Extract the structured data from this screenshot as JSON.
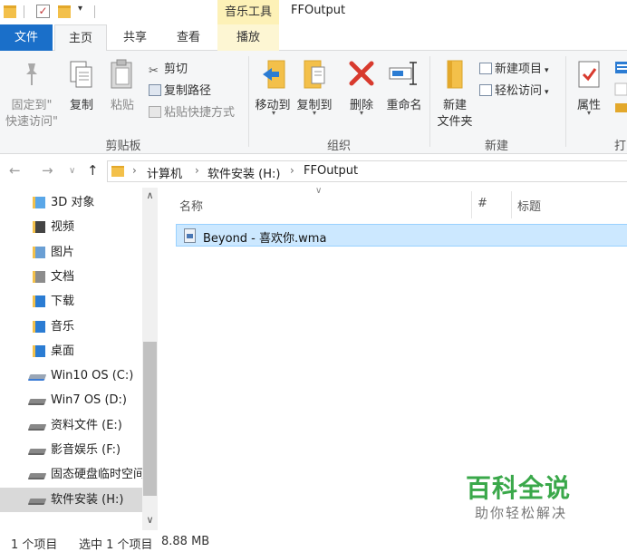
{
  "window": {
    "title": "FFOutput",
    "context_tab_group": "音乐工具"
  },
  "quick_access": {
    "dropdown_glyph": "▾",
    "check_glyph": "✓"
  },
  "tabs": {
    "file": "文件",
    "home": "主页",
    "share": "共享",
    "view": "查看",
    "play": "播放"
  },
  "ribbon": {
    "clipboard": {
      "label": "剪贴板",
      "pin_line1": "固定到\"",
      "pin_line2": "快速访问\"",
      "copy": "复制",
      "paste": "粘贴",
      "cut": "剪切",
      "copy_path": "复制路径",
      "paste_shortcut": "粘贴快捷方式"
    },
    "organize": {
      "label": "组织",
      "move_to": "移动到",
      "copy_to": "复制到",
      "delete": "删除",
      "rename": "重命名"
    },
    "new": {
      "label": "新建",
      "new_folder_line1": "新建",
      "new_folder_line2": "文件夹",
      "new_item": "新建项目",
      "easy_access": "轻松访问"
    },
    "open": {
      "label": "打",
      "properties": "属性"
    }
  },
  "address": {
    "back_glyph": "←",
    "forward_glyph": "→",
    "recent_glyph": "∨",
    "up_glyph": "↑",
    "separator": "›",
    "crumbs": [
      "计算机",
      "软件安装 (H:)",
      "FFOutput"
    ]
  },
  "nav_pane": {
    "items": [
      {
        "label": "3D 对象",
        "icon": "3d-objects-icon",
        "color": "#5aa7e8"
      },
      {
        "label": "视频",
        "icon": "video-icon",
        "color": "#444444"
      },
      {
        "label": "图片",
        "icon": "pictures-icon",
        "color": "#6a9fd4"
      },
      {
        "label": "文档",
        "icon": "documents-icon",
        "color": "#8c8c8c"
      },
      {
        "label": "下载",
        "icon": "downloads-icon",
        "color": "#2b7cd3"
      },
      {
        "label": "音乐",
        "icon": "music-icon",
        "color": "#2b7cd3"
      },
      {
        "label": "桌面",
        "icon": "desktop-icon",
        "color": "#2b7cd3"
      },
      {
        "label": "Win10 OS (C:)",
        "icon": "system-drive-icon",
        "color": "#3a7bd5"
      },
      {
        "label": "Win7 OS (D:)",
        "icon": "drive-icon",
        "color": "#888888"
      },
      {
        "label": "资料文件 (E:)",
        "icon": "drive-icon",
        "color": "#888888"
      },
      {
        "label": "影音娱乐 (F:)",
        "icon": "drive-icon",
        "color": "#888888"
      },
      {
        "label": "固态硬盘临时空间",
        "icon": "drive-icon",
        "color": "#888888"
      },
      {
        "label": "软件安装 (H:)",
        "icon": "drive-icon",
        "color": "#888888",
        "selected": true
      }
    ],
    "scroll_up_glyph": "∧",
    "scroll_down_glyph": "∨"
  },
  "file_list": {
    "columns": [
      "名称",
      "#",
      "标题"
    ],
    "sort_glyph": "∨",
    "files": [
      {
        "name": "Beyond - 喜欢你.wma",
        "selected": true
      }
    ]
  },
  "watermark": {
    "title": "百科全说",
    "subtitle": "助你轻松解决"
  },
  "status_bar": {
    "item_count": "1 个项目",
    "selected": "选中 1 个项目",
    "size": "8.88 MB"
  },
  "colors": {
    "file_tab": "#1a6fc9",
    "context_tab": "#fdf1b7",
    "selection": "#cce8ff",
    "watermark": "#3aa84a",
    "delete_red": "#d83a2e"
  }
}
